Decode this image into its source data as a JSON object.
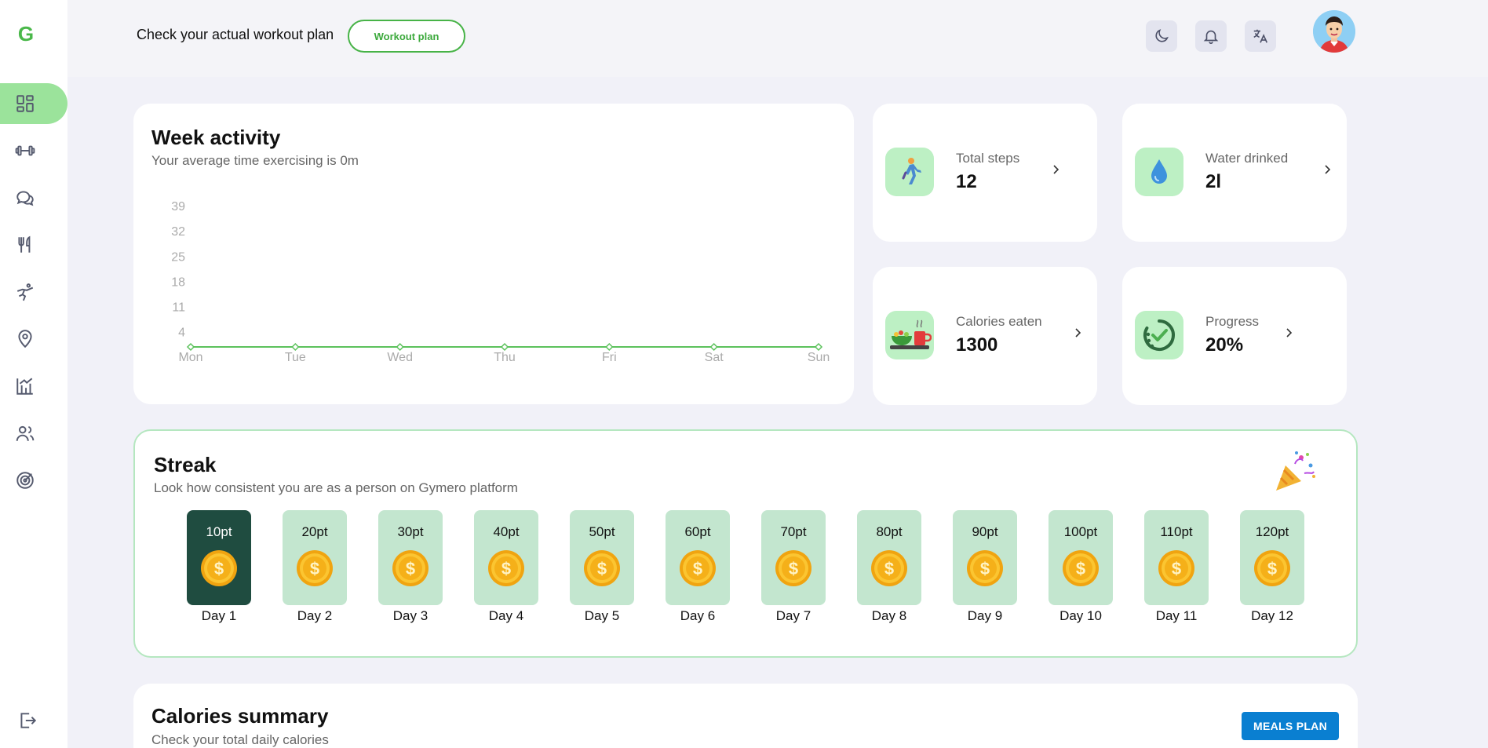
{
  "sidebar": {
    "logo": "G",
    "items": [
      {
        "name": "dashboard-icon",
        "active": true
      },
      {
        "name": "dumbbell-icon",
        "active": false
      },
      {
        "name": "chat-icon",
        "active": false
      },
      {
        "name": "fork-knife-icon",
        "active": false
      },
      {
        "name": "exercise-icon",
        "active": false
      },
      {
        "name": "location-pin-icon",
        "active": false
      },
      {
        "name": "chart-growth-icon",
        "active": false
      },
      {
        "name": "users-icon",
        "active": false
      },
      {
        "name": "target-icon",
        "active": false
      }
    ],
    "logout_icon": "logout-icon"
  },
  "header": {
    "text": "Check your actual workout plan",
    "workout_button": "Workout plan",
    "icons": [
      "moon-icon",
      "bell-icon",
      "translate-icon"
    ]
  },
  "week_activity": {
    "title": "Week activity",
    "subtitle": "Your average time exercising is 0m"
  },
  "chart_data": {
    "type": "line",
    "categories": [
      "Mon",
      "Tue",
      "Wed",
      "Thu",
      "Fri",
      "Sat",
      "Sun"
    ],
    "series": [
      {
        "values": [
          0,
          0,
          0,
          0,
          0,
          0,
          0
        ]
      }
    ],
    "yticks": [
      4,
      11,
      18,
      25,
      32,
      39
    ],
    "ylim": [
      0,
      39
    ],
    "grid": false,
    "color": "#5cc25c"
  },
  "stats": [
    {
      "label": "Total steps",
      "value": "12",
      "icon": "walking-person-icon"
    },
    {
      "label": "Water drinked",
      "value": "2l",
      "icon": "water-drop-icon"
    },
    {
      "label": "Calories eaten",
      "value": "1300",
      "icon": "food-tray-icon"
    },
    {
      "label": "Progress",
      "value": "20%",
      "icon": "progress-check-icon"
    }
  ],
  "streak": {
    "title": "Streak",
    "subtitle": "Look how consistent you are as a person on Gymero platform",
    "days": [
      {
        "pts": "10pt",
        "label": "Day 1"
      },
      {
        "pts": "20pt",
        "label": "Day 2"
      },
      {
        "pts": "30pt",
        "label": "Day 3"
      },
      {
        "pts": "40pt",
        "label": "Day 4"
      },
      {
        "pts": "50pt",
        "label": "Day 5"
      },
      {
        "pts": "60pt",
        "label": "Day 6"
      },
      {
        "pts": "70pt",
        "label": "Day 7"
      },
      {
        "pts": "80pt",
        "label": "Day 8"
      },
      {
        "pts": "90pt",
        "label": "Day 9"
      },
      {
        "pts": "100pt",
        "label": "Day 10"
      },
      {
        "pts": "110pt",
        "label": "Day 11"
      },
      {
        "pts": "120pt",
        "label": "Day 12"
      }
    ],
    "active_day": "Day 1"
  },
  "calories": {
    "title": "Calories summary",
    "subtitle": "Check your total daily calories",
    "meals_button": "MEALS PLAN"
  },
  "colors": {
    "accent": "#47b347",
    "nav_active": "#9be39b",
    "streak_active": "#1f4c40",
    "streak_box": "#c3e6cf",
    "meals_button": "#0a7fd1"
  }
}
